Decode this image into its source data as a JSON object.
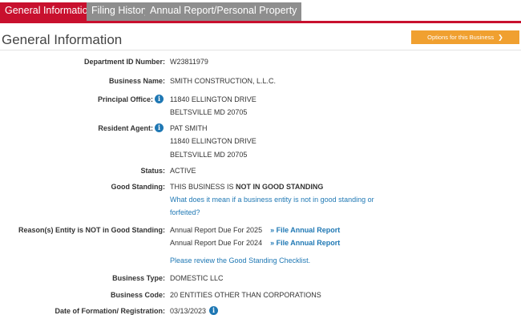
{
  "tabs": [
    {
      "label": "General Information"
    },
    {
      "label": "Filing History"
    },
    {
      "label": "Annual Report/Personal Property"
    }
  ],
  "section_title": "General Information",
  "options_button": {
    "label": "Options for this Business",
    "icon": "chevron-down-icon"
  },
  "colors": {
    "accent": "#c8102e",
    "tab_inactive": "#8e8e8e",
    "button": "#f0a030",
    "link": "#1f78b4"
  },
  "fields": {
    "department_id": {
      "label": "Department ID Number:",
      "value": "W23811979"
    },
    "business_name": {
      "label": "Business Name:",
      "value": "SMITH CONSTRUCTION, L.L.C."
    },
    "principal_office": {
      "label": "Principal Office:",
      "line1": "11840 ELLINGTON DRIVE",
      "line2": "BELTSVILLE MD 20705"
    },
    "resident_agent": {
      "label": "Resident Agent:",
      "line1": "PAT SMITH",
      "line2": "11840 ELLINGTON DRIVE",
      "line3": "BELTSVILLE MD 20705"
    },
    "status": {
      "label": "Status:",
      "value": "ACTIVE"
    },
    "good_standing": {
      "label": "Good Standing:",
      "prefix": "THIS BUSINESS IS ",
      "bold": "NOT IN GOOD STANDING",
      "link_line1": "What does it mean if a business entity is not in good standing or",
      "link_line2": "forfeited?"
    },
    "reasons": {
      "label": "Reason(s) Entity is NOT in Good Standing:",
      "items": [
        {
          "text": "Annual Report Due For 2025",
          "action": "» File Annual Report"
        },
        {
          "text": "Annual Report Due For 2024",
          "action": "» File Annual Report"
        }
      ],
      "checklist_prefix": "Please review the ",
      "checklist_link": "Good Standing Checklist",
      "checklist_suffix": "."
    },
    "business_type": {
      "label": "Business Type:",
      "value": "DOMESTIC LLC"
    },
    "business_code": {
      "label": "Business Code:",
      "value": "20 ENTITIES OTHER THAN CORPORATIONS"
    },
    "date_of_formation": {
      "label": "Date of Formation/ Registration:",
      "value": "03/13/2023"
    }
  }
}
